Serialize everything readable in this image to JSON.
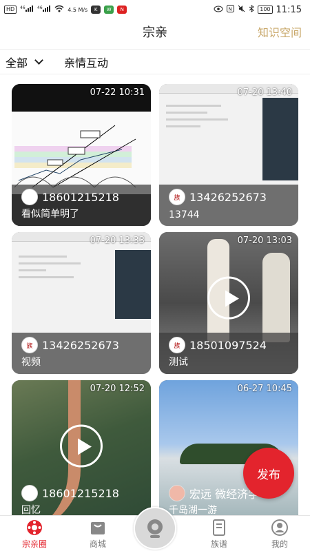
{
  "status_bar": {
    "left": [
      "HD",
      "46",
      "46",
      "4.5 M/s"
    ],
    "battery": "100",
    "time": "11:15"
  },
  "header": {
    "title": "宗亲",
    "right_link": "知识空间"
  },
  "filters": {
    "dropdown": "全部",
    "tab": "亲情互动"
  },
  "cards": [
    {
      "timestamp": "07-22 10:31",
      "author": "18601215218",
      "caption": "看似简单明了",
      "has_play": false
    },
    {
      "timestamp": "07-20 13:40",
      "author": "13426252673",
      "caption": "13744",
      "has_play": false
    },
    {
      "timestamp": "07-20 13:33",
      "author": "13426252673",
      "caption": "视频",
      "has_play": false
    },
    {
      "timestamp": "07-20 13:03",
      "author": "18501097524",
      "caption": "测试",
      "has_play": true
    },
    {
      "timestamp": "07-20 12:52",
      "author": "18601215218",
      "caption": "回忆",
      "has_play": true
    },
    {
      "timestamp": "06-27 10:45",
      "author": "宏远 微经济学",
      "caption": "千岛湖一游",
      "has_play": false
    }
  ],
  "fab": {
    "label": "发布"
  },
  "bottom_nav": {
    "items": [
      {
        "label": "宗亲圈",
        "icon": "circle-dots-icon"
      },
      {
        "label": "商城",
        "icon": "shopping-bag-icon"
      },
      {
        "label": "",
        "icon": "camera-icon"
      },
      {
        "label": "族谱",
        "icon": "book-icon"
      },
      {
        "label": "我的",
        "icon": "person-icon"
      }
    ],
    "active_color": "#e3242d",
    "inactive_color": "#777777"
  },
  "colors": {
    "accent": "#e3242d",
    "gold": "#c9a86b"
  }
}
